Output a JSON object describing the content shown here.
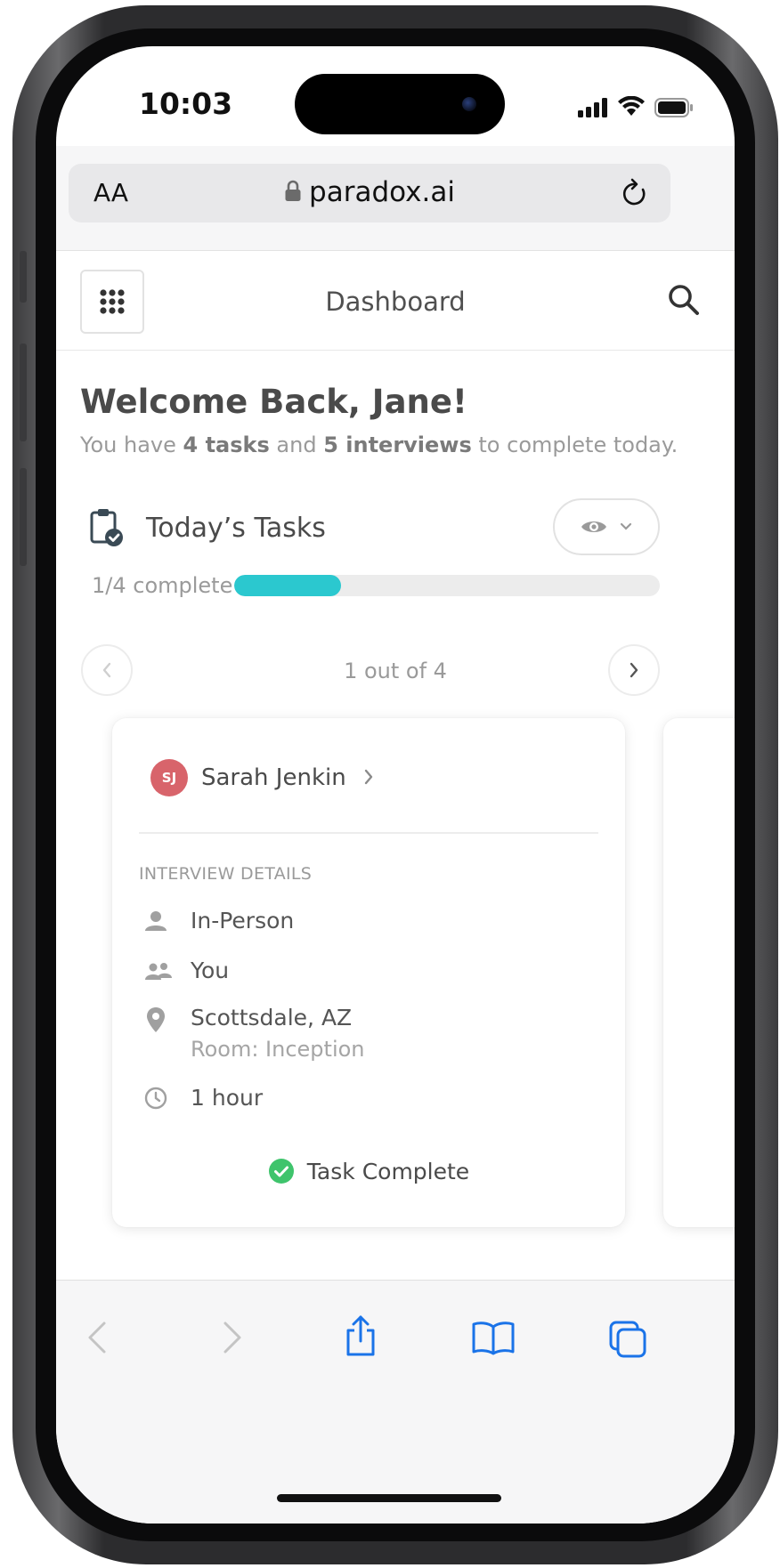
{
  "status_bar": {
    "time": "10:03",
    "icons": [
      "signal-icon",
      "wifi-icon",
      "battery-icon"
    ]
  },
  "browser": {
    "text_size_label": "AA",
    "url": "paradox.ai",
    "lock_icon": "lock-icon",
    "reload_icon": "reload-icon"
  },
  "header": {
    "menu_icon": "grid-menu-icon",
    "title": "Dashboard",
    "search_icon": "search-icon"
  },
  "welcome": {
    "title": "Welcome Back, Jane!",
    "sub_prefix": "You have ",
    "tasks_count": "4 tasks",
    "sub_middle": " and ",
    "interviews_count": "5 interviews",
    "sub_suffix": " to complete today."
  },
  "tasks": {
    "title": "Today’s Tasks",
    "progress_label": "1/4 complete",
    "progress_fraction": 0.25,
    "pager_text": "1 out of 4"
  },
  "card": {
    "candidate_initials": "SJ",
    "candidate_name": "Sarah Jenkin",
    "section_label": "INTERVIEW DETAILS",
    "details": {
      "type": "In-Person",
      "interviewer": "You",
      "location": "Scottsdale, AZ",
      "room": "Room: Inception",
      "duration": "1 hour"
    },
    "status": "Task Complete"
  },
  "colors": {
    "accent": "#2bc8cf",
    "avatar": "#d8646b",
    "success": "#3fc46c",
    "ios_blue": "#1a73e8"
  }
}
